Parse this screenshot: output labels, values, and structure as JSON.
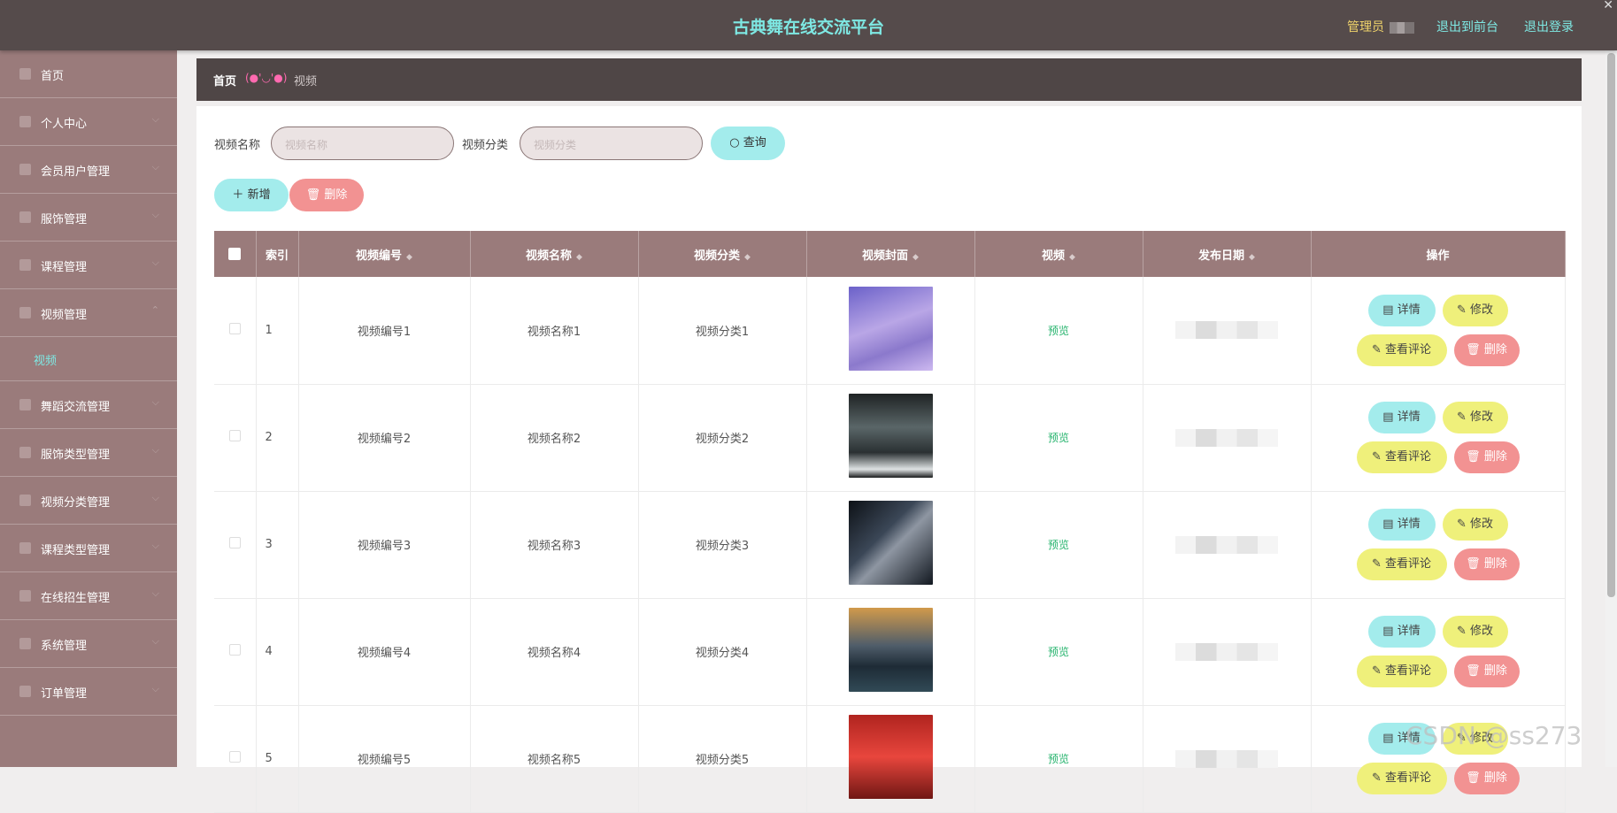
{
  "header": {
    "title": "古典舞在线交流平台",
    "admin_label": "管理员",
    "link_front": "退出到前台",
    "link_logout": "退出登录"
  },
  "sidebar": {
    "items": [
      {
        "label": "首页"
      },
      {
        "label": "个人中心"
      },
      {
        "label": "会员用户管理"
      },
      {
        "label": "服饰管理"
      },
      {
        "label": "课程管理"
      },
      {
        "label": "视频管理"
      },
      {
        "label": "视频"
      },
      {
        "label": "舞蹈交流管理"
      },
      {
        "label": "服饰类型管理"
      },
      {
        "label": "视频分类管理"
      },
      {
        "label": "课程类型管理"
      },
      {
        "label": "在线招生管理"
      },
      {
        "label": "系统管理"
      },
      {
        "label": "订单管理"
      }
    ]
  },
  "breadcrumb": {
    "home": "首页",
    "emoticon": "(●'◡'●)",
    "current": "视频"
  },
  "search": {
    "name_label": "视频名称",
    "name_placeholder": "视频名称",
    "category_label": "视频分类",
    "category_placeholder": "视频分类",
    "search_button": "查询"
  },
  "actions": {
    "add": "新增",
    "delete": "删除"
  },
  "table": {
    "columns": [
      "索引",
      "视频编号",
      "视频名称",
      "视频分类",
      "视频封面",
      "视频",
      "发布日期",
      "操作"
    ],
    "rows": [
      {
        "index": "1",
        "code": "视频编号1",
        "name": "视频名称1",
        "category": "视频分类1",
        "video": "预览"
      },
      {
        "index": "2",
        "code": "视频编号2",
        "name": "视频名称2",
        "category": "视频分类2",
        "video": "预览"
      },
      {
        "index": "3",
        "code": "视频编号3",
        "name": "视频名称3",
        "category": "视频分类3",
        "video": "预览"
      },
      {
        "index": "4",
        "code": "视频编号4",
        "name": "视频名称4",
        "category": "视频分类4",
        "video": "预览"
      },
      {
        "index": "5",
        "code": "视频编号5",
        "name": "视频名称5",
        "category": "视频分类5",
        "video": "预览"
      }
    ],
    "op_detail": "详情",
    "op_edit": "修改",
    "op_comment": "查看评论",
    "op_delete": "删除"
  },
  "watermark": "CSDN @ss273"
}
